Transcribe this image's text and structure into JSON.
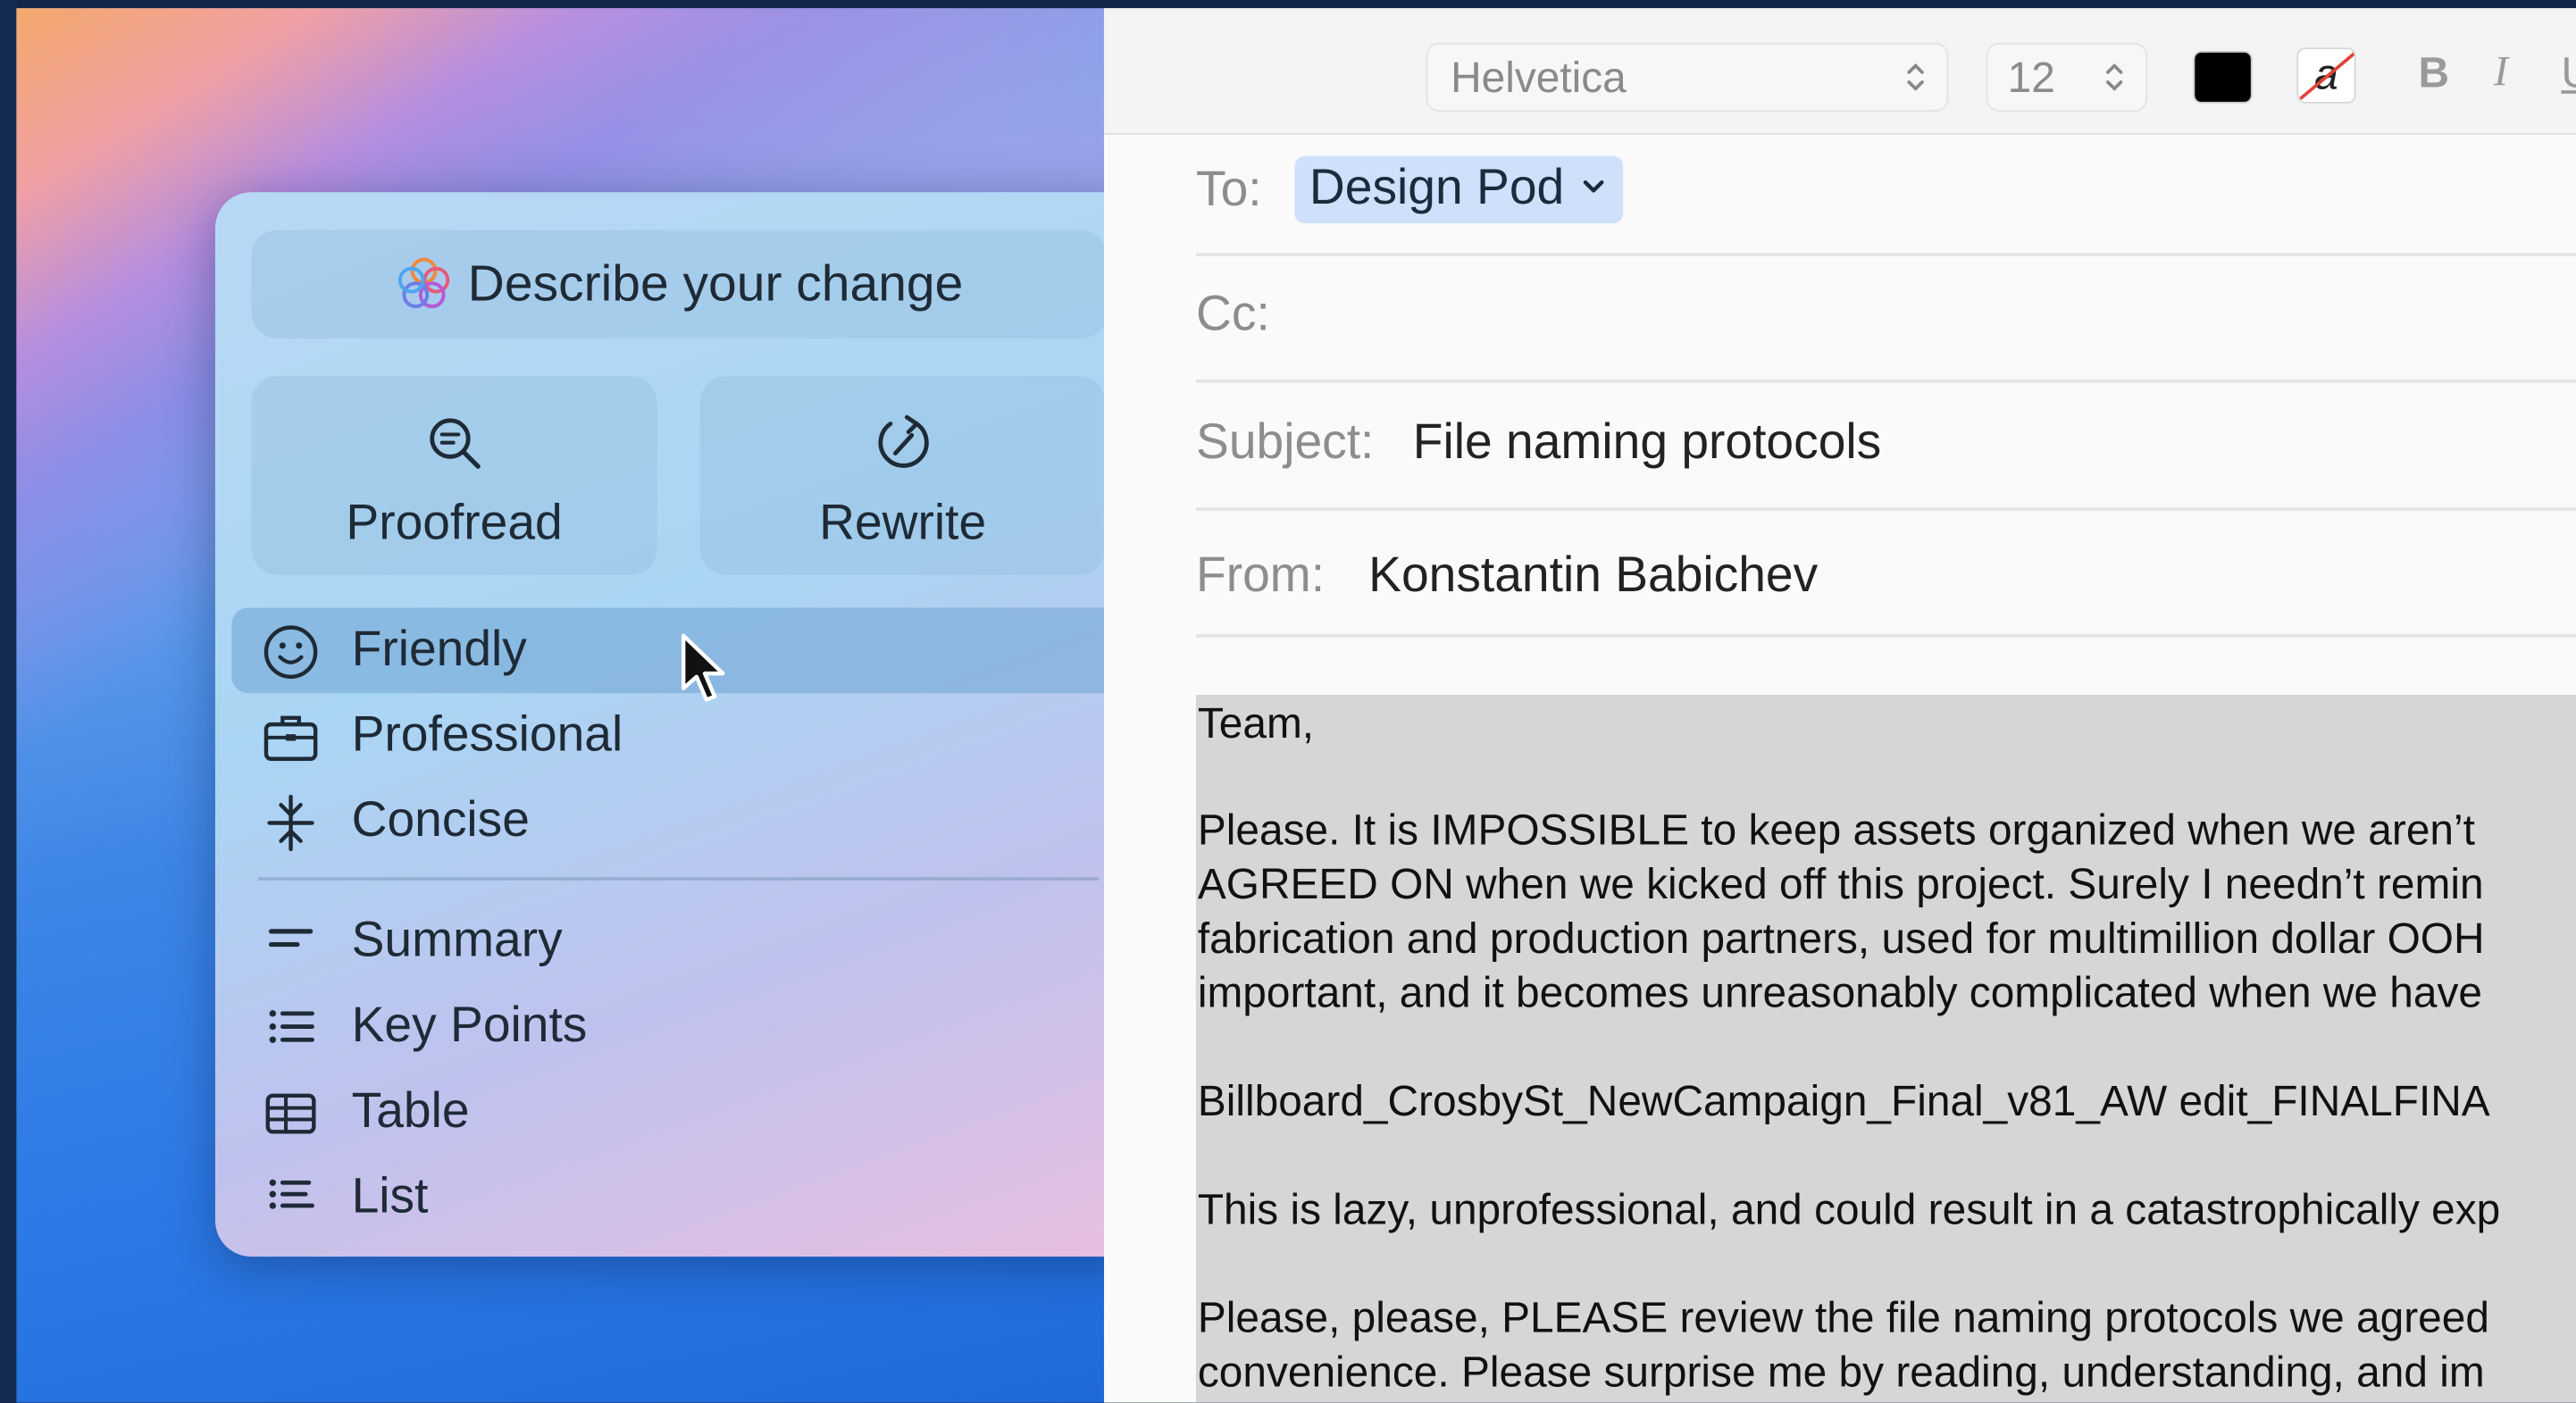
{
  "popover": {
    "describe_label": "Describe your change",
    "proofread_label": "Proofread",
    "rewrite_label": "Rewrite",
    "tones": [
      {
        "label": "Friendly",
        "icon": "smiley-icon",
        "selected": true
      },
      {
        "label": "Professional",
        "icon": "briefcase-icon",
        "selected": false
      },
      {
        "label": "Concise",
        "icon": "compress-icon",
        "selected": false
      }
    ],
    "formats": [
      {
        "label": "Summary",
        "icon": "summary-icon"
      },
      {
        "label": "Key Points",
        "icon": "bullet-list-icon"
      },
      {
        "label": "Table",
        "icon": "table-icon"
      },
      {
        "label": "List",
        "icon": "list-icon"
      }
    ]
  },
  "toolbar": {
    "font": "Helvetica",
    "size": "12",
    "text_color": "#000000",
    "bold": "B",
    "italic": "I",
    "underline": "U",
    "bg_swatch_glyph": "a"
  },
  "mail": {
    "to_label": "To:",
    "to_value": "Design Pod",
    "cc_label": "Cc:",
    "subject_label": "Subject:",
    "subject_value": "File naming protocols",
    "from_label": "From:",
    "from_value": "Konstantin Babichev",
    "body": [
      "Team,",
      "Please. It is IMPOSSIBLE to keep assets organized when we aren’t",
      "AGREED ON when we kicked off this project. Surely I needn’t remin",
      "fabrication and production partners, used for multimillion dollar OOH",
      "important, and it becomes unreasonably complicated when we have",
      "Billboard_CrosbySt_NewCampaign_Final_v81_AW edit_FINALFINA",
      "This is lazy, unprofessional, and could result in a catastrophically exp",
      "Please, please, PLEASE review the file naming protocols we agreed",
      "convenience. Please surprise me by reading, understanding, and im"
    ]
  },
  "colors": {
    "accent_chip": "#cfe0fb",
    "selection_gray": "#d6d6d6"
  }
}
